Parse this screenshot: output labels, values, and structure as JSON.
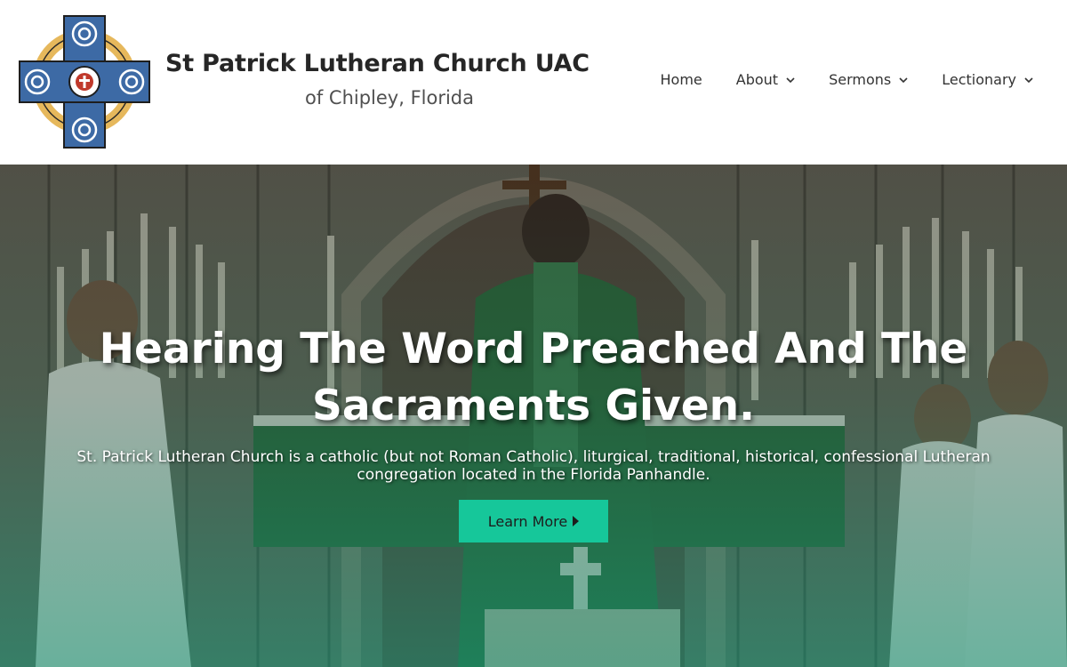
{
  "header": {
    "site_title": "St Patrick Lutheran Church UAC",
    "site_subtitle": "of Chipley, Florida",
    "logo_icon": "celtic-cross-luther-rose-icon",
    "nav": [
      {
        "label": "Home",
        "has_dropdown": false
      },
      {
        "label": "About",
        "has_dropdown": true
      },
      {
        "label": "Sermons",
        "has_dropdown": true
      },
      {
        "label": "Lectionary",
        "has_dropdown": true
      }
    ]
  },
  "hero": {
    "title_line1": "Hearing The Word Preached And The",
    "title_line2": "Sacraments Given.",
    "description_line1": "St. Patrick Lutheran Church is a catholic (but not Roman Catholic), liturgical, traditional, historical, confessional Lutheran",
    "description_line2": "congregation located in the Florida Panhandle.",
    "button_label": "Learn More",
    "button_icon": "caret-right-icon"
  },
  "colors": {
    "accent": "#16c79a",
    "heading": "#262626",
    "logo_blue": "#3d6aa5",
    "logo_gold": "#e6b85c"
  }
}
